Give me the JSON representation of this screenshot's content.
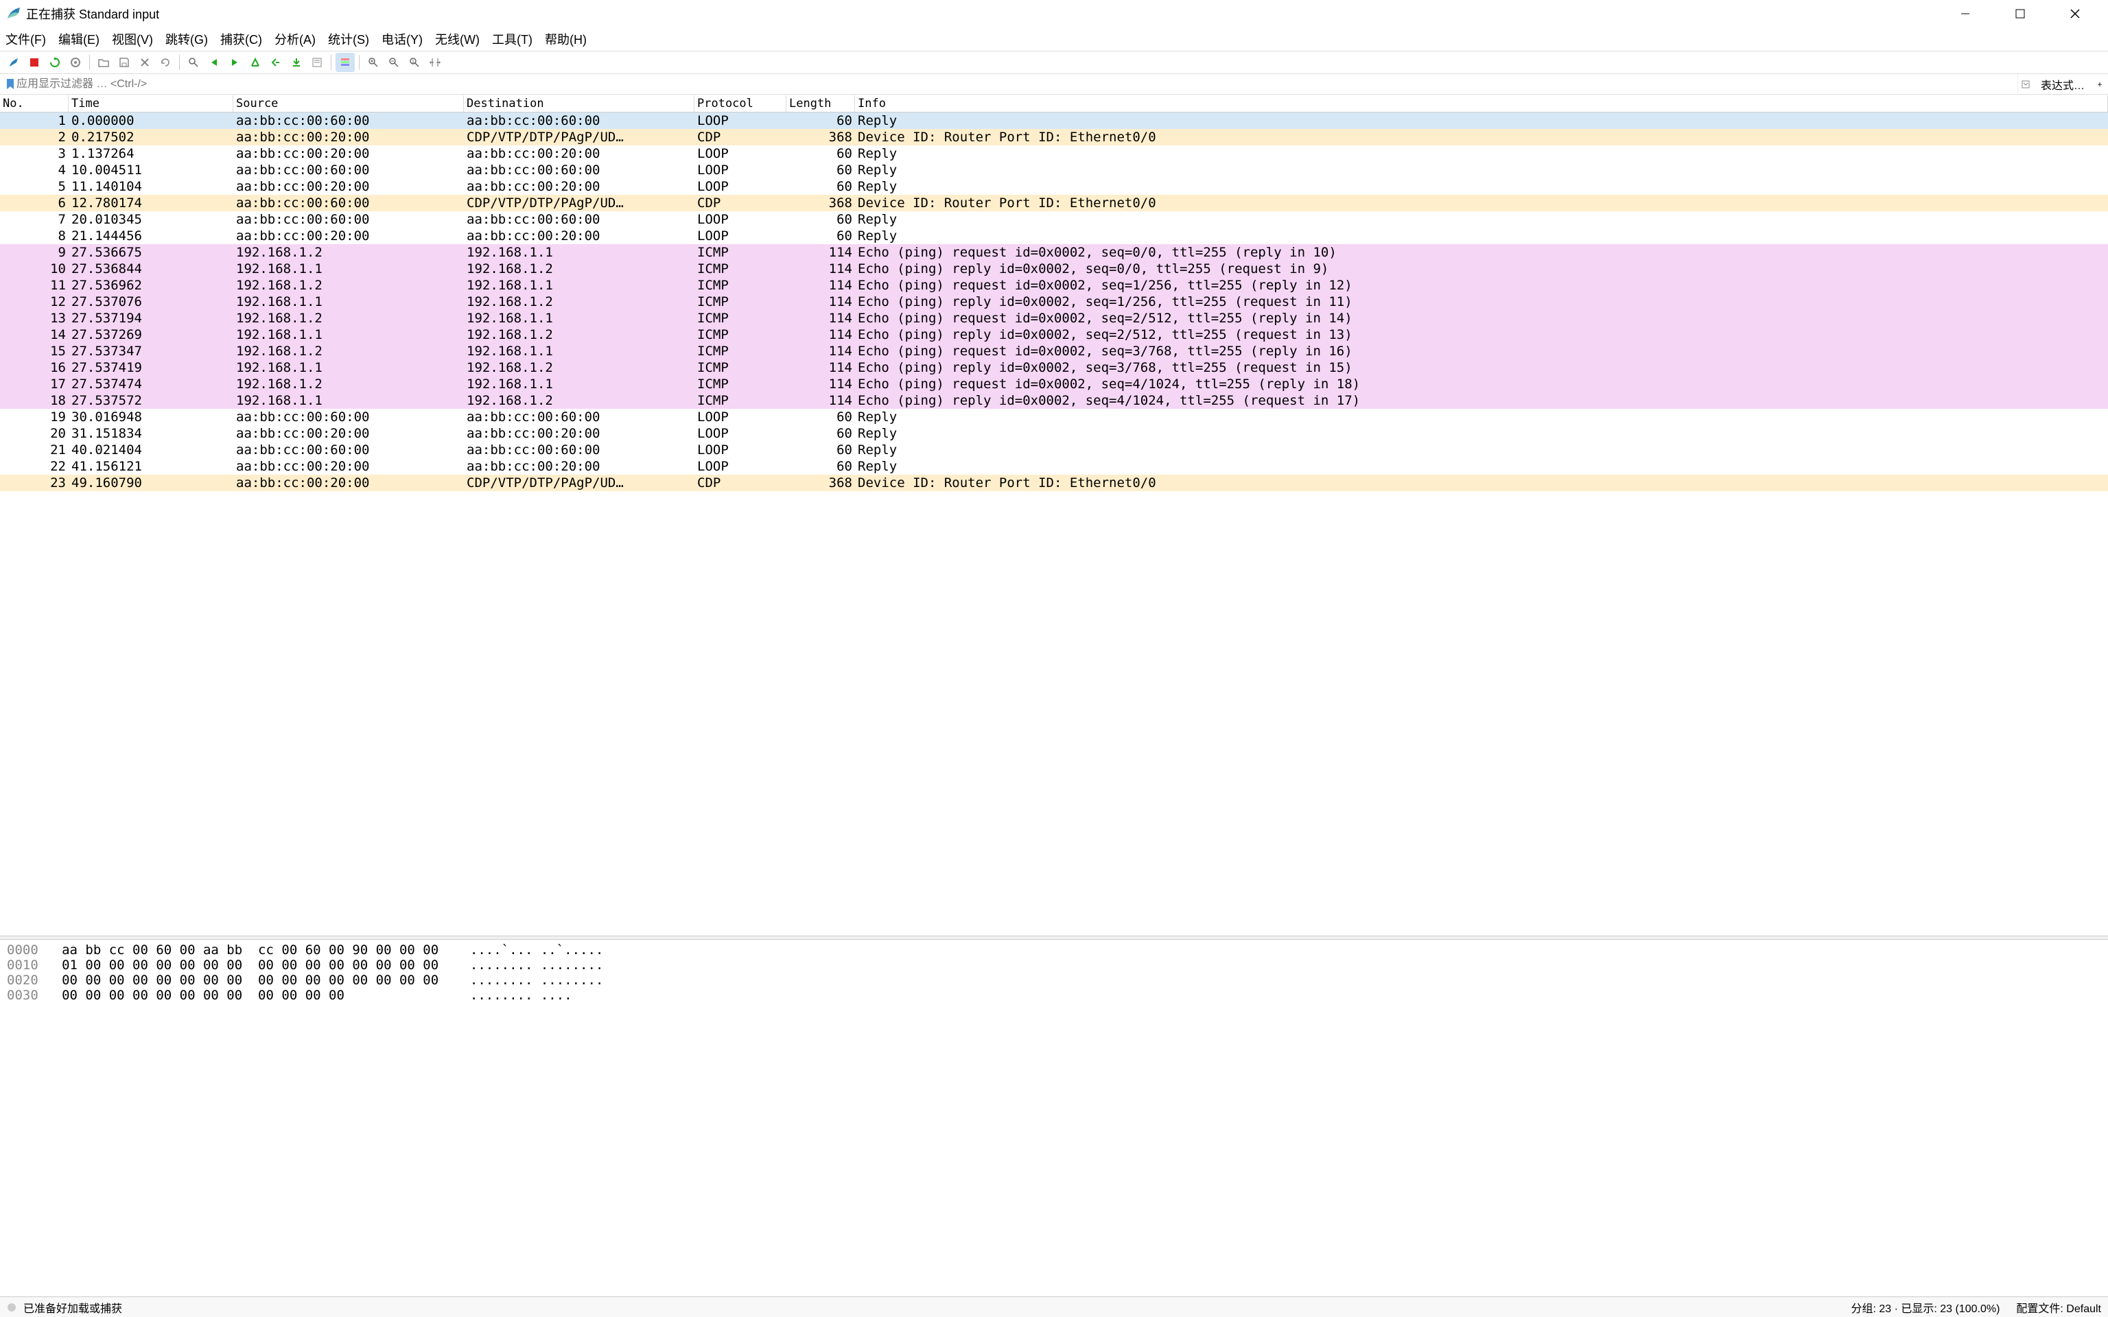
{
  "window": {
    "title": "正在捕获 Standard input"
  },
  "menu": {
    "file": "文件(F)",
    "edit": "编辑(E)",
    "view": "视图(V)",
    "go": "跳转(G)",
    "capture": "捕获(C)",
    "analyze": "分析(A)",
    "stats": "统计(S)",
    "telephony": "电话(Y)",
    "wireless": "无线(W)",
    "tools": "工具(T)",
    "help": "帮助(H)"
  },
  "filter": {
    "placeholder": "应用显示过滤器 … <Ctrl-/>",
    "expr": "表达式…",
    "plus": "+"
  },
  "columns": {
    "no": "No.",
    "time": "Time",
    "src": "Source",
    "dst": "Destination",
    "proto": "Protocol",
    "len": "Length",
    "info": "Info"
  },
  "packets": [
    {
      "n": 1,
      "t": "0.000000",
      "s": "aa:bb:cc:00:60:00",
      "d": "aa:bb:cc:00:60:00",
      "p": "LOOP",
      "l": 60,
      "i": "Reply",
      "k": "sel"
    },
    {
      "n": 2,
      "t": "0.217502",
      "s": "aa:bb:cc:00:20:00",
      "d": "CDP/VTP/DTP/PAgP/UD…",
      "p": "CDP",
      "l": 368,
      "i": "Device ID: Router  Port ID: Ethernet0/0",
      "k": "cdp"
    },
    {
      "n": 3,
      "t": "1.137264",
      "s": "aa:bb:cc:00:20:00",
      "d": "aa:bb:cc:00:20:00",
      "p": "LOOP",
      "l": 60,
      "i": "Reply",
      "k": ""
    },
    {
      "n": 4,
      "t": "10.004511",
      "s": "aa:bb:cc:00:60:00",
      "d": "aa:bb:cc:00:60:00",
      "p": "LOOP",
      "l": 60,
      "i": "Reply",
      "k": ""
    },
    {
      "n": 5,
      "t": "11.140104",
      "s": "aa:bb:cc:00:20:00",
      "d": "aa:bb:cc:00:20:00",
      "p": "LOOP",
      "l": 60,
      "i": "Reply",
      "k": ""
    },
    {
      "n": 6,
      "t": "12.780174",
      "s": "aa:bb:cc:00:60:00",
      "d": "CDP/VTP/DTP/PAgP/UD…",
      "p": "CDP",
      "l": 368,
      "i": "Device ID: Router  Port ID: Ethernet0/0",
      "k": "cdp"
    },
    {
      "n": 7,
      "t": "20.010345",
      "s": "aa:bb:cc:00:60:00",
      "d": "aa:bb:cc:00:60:00",
      "p": "LOOP",
      "l": 60,
      "i": "Reply",
      "k": ""
    },
    {
      "n": 8,
      "t": "21.144456",
      "s": "aa:bb:cc:00:20:00",
      "d": "aa:bb:cc:00:20:00",
      "p": "LOOP",
      "l": 60,
      "i": "Reply",
      "k": ""
    },
    {
      "n": 9,
      "t": "27.536675",
      "s": "192.168.1.2",
      "d": "192.168.1.1",
      "p": "ICMP",
      "l": 114,
      "i": "Echo (ping) request  id=0x0002, seq=0/0, ttl=255 (reply in 10)",
      "k": "icmp"
    },
    {
      "n": 10,
      "t": "27.536844",
      "s": "192.168.1.1",
      "d": "192.168.1.2",
      "p": "ICMP",
      "l": 114,
      "i": "Echo (ping) reply    id=0x0002, seq=0/0, ttl=255 (request in 9)",
      "k": "icmp"
    },
    {
      "n": 11,
      "t": "27.536962",
      "s": "192.168.1.2",
      "d": "192.168.1.1",
      "p": "ICMP",
      "l": 114,
      "i": "Echo (ping) request  id=0x0002, seq=1/256, ttl=255 (reply in 12)",
      "k": "icmp"
    },
    {
      "n": 12,
      "t": "27.537076",
      "s": "192.168.1.1",
      "d": "192.168.1.2",
      "p": "ICMP",
      "l": 114,
      "i": "Echo (ping) reply    id=0x0002, seq=1/256, ttl=255 (request in 11)",
      "k": "icmp"
    },
    {
      "n": 13,
      "t": "27.537194",
      "s": "192.168.1.2",
      "d": "192.168.1.1",
      "p": "ICMP",
      "l": 114,
      "i": "Echo (ping) request  id=0x0002, seq=2/512, ttl=255 (reply in 14)",
      "k": "icmp"
    },
    {
      "n": 14,
      "t": "27.537269",
      "s": "192.168.1.1",
      "d": "192.168.1.2",
      "p": "ICMP",
      "l": 114,
      "i": "Echo (ping) reply    id=0x0002, seq=2/512, ttl=255 (request in 13)",
      "k": "icmp"
    },
    {
      "n": 15,
      "t": "27.537347",
      "s": "192.168.1.2",
      "d": "192.168.1.1",
      "p": "ICMP",
      "l": 114,
      "i": "Echo (ping) request  id=0x0002, seq=3/768, ttl=255 (reply in 16)",
      "k": "icmp"
    },
    {
      "n": 16,
      "t": "27.537419",
      "s": "192.168.1.1",
      "d": "192.168.1.2",
      "p": "ICMP",
      "l": 114,
      "i": "Echo (ping) reply    id=0x0002, seq=3/768, ttl=255 (request in 15)",
      "k": "icmp"
    },
    {
      "n": 17,
      "t": "27.537474",
      "s": "192.168.1.2",
      "d": "192.168.1.1",
      "p": "ICMP",
      "l": 114,
      "i": "Echo (ping) request  id=0x0002, seq=4/1024, ttl=255 (reply in 18)",
      "k": "icmp"
    },
    {
      "n": 18,
      "t": "27.537572",
      "s": "192.168.1.1",
      "d": "192.168.1.2",
      "p": "ICMP",
      "l": 114,
      "i": "Echo (ping) reply    id=0x0002, seq=4/1024, ttl=255 (request in 17)",
      "k": "icmp"
    },
    {
      "n": 19,
      "t": "30.016948",
      "s": "aa:bb:cc:00:60:00",
      "d": "aa:bb:cc:00:60:00",
      "p": "LOOP",
      "l": 60,
      "i": "Reply",
      "k": ""
    },
    {
      "n": 20,
      "t": "31.151834",
      "s": "aa:bb:cc:00:20:00",
      "d": "aa:bb:cc:00:20:00",
      "p": "LOOP",
      "l": 60,
      "i": "Reply",
      "k": ""
    },
    {
      "n": 21,
      "t": "40.021404",
      "s": "aa:bb:cc:00:60:00",
      "d": "aa:bb:cc:00:60:00",
      "p": "LOOP",
      "l": 60,
      "i": "Reply",
      "k": ""
    },
    {
      "n": 22,
      "t": "41.156121",
      "s": "aa:bb:cc:00:20:00",
      "d": "aa:bb:cc:00:20:00",
      "p": "LOOP",
      "l": 60,
      "i": "Reply",
      "k": ""
    },
    {
      "n": 23,
      "t": "49.160790",
      "s": "aa:bb:cc:00:20:00",
      "d": "CDP/VTP/DTP/PAgP/UD…",
      "p": "CDP",
      "l": 368,
      "i": "Device ID: Router  Port ID: Ethernet0/0",
      "k": "cdp"
    }
  ],
  "hex": [
    {
      "off": "0000",
      "b": "aa bb cc 00 60 00 aa bb  cc 00 60 00 90 00 00 00",
      "a": "....`... ..`....."
    },
    {
      "off": "0010",
      "b": "01 00 00 00 00 00 00 00  00 00 00 00 00 00 00 00",
      "a": "........ ........"
    },
    {
      "off": "0020",
      "b": "00 00 00 00 00 00 00 00  00 00 00 00 00 00 00 00",
      "a": "........ ........"
    },
    {
      "off": "0030",
      "b": "00 00 00 00 00 00 00 00  00 00 00 00",
      "a": "........ ...."
    }
  ],
  "status": {
    "ready": "已准备好加载或捕获",
    "packets": "分组: 23 · 已显示: 23 (100.0%)",
    "profile": "配置文件: Default"
  }
}
